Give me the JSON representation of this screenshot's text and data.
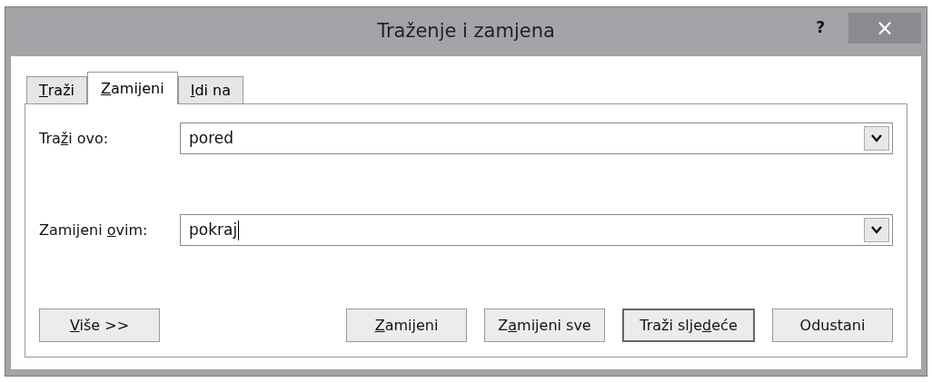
{
  "window": {
    "title": "Traženje i zamjena",
    "help": "?",
    "close": "×"
  },
  "tabs": [
    {
      "key": "T",
      "post": "raži",
      "selected": false
    },
    {
      "key": "Z",
      "post": "amijeni",
      "selected": true
    },
    {
      "key": "I",
      "post": "di na",
      "selected": false
    }
  ],
  "fields": [
    {
      "label": {
        "pre": "Tra",
        "key": "ž",
        "post": "i ovo:"
      },
      "value": "pored",
      "focused": false
    },
    {
      "label": {
        "pre": "Zamijeni ",
        "key": "o",
        "post": "vim:"
      },
      "value": "pokraj",
      "focused": true
    }
  ],
  "more_button": {
    "key": "V",
    "post": "iše >>"
  },
  "buttons": [
    {
      "key": "Z",
      "post": "amijeni",
      "default": false
    },
    {
      "pre": "Z",
      "key": "a",
      "post": "mijeni sve",
      "default": false
    },
    {
      "pre": "Traži slje",
      "key": "d",
      "post": "eće",
      "default": true
    },
    {
      "pre": "Odustani",
      "default": false
    }
  ]
}
